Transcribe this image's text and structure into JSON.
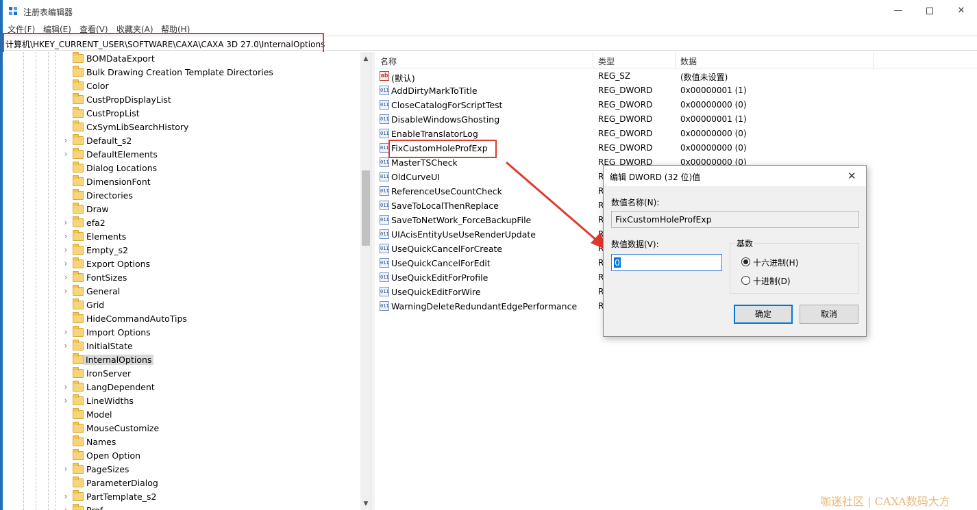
{
  "window": {
    "title": "注册表编辑器",
    "minimize_icon": "minimize-icon",
    "maximize_icon": "maximize-icon",
    "close_icon": "close-icon"
  },
  "menu": [
    "文件(F)",
    "编辑(E)",
    "查看(V)",
    "收藏夹(A)",
    "帮助(H)"
  ],
  "address": "计算机\\HKEY_CURRENT_USER\\SOFTWARE\\CAXA\\CAXA 3D 27.0\\InternalOptions",
  "tree": [
    {
      "label": "BOMDataExport",
      "expandable": false
    },
    {
      "label": "Bulk Drawing Creation Template Directories",
      "expandable": false
    },
    {
      "label": "Color",
      "expandable": false
    },
    {
      "label": "CustPropDisplayList",
      "expandable": false
    },
    {
      "label": "CustPropList",
      "expandable": false
    },
    {
      "label": "CxSymLibSearchHistory",
      "expandable": false
    },
    {
      "label": "Default_s2",
      "expandable": true
    },
    {
      "label": "DefaultElements",
      "expandable": true
    },
    {
      "label": "Dialog Locations",
      "expandable": false
    },
    {
      "label": "DimensionFont",
      "expandable": false
    },
    {
      "label": "Directories",
      "expandable": false
    },
    {
      "label": "Draw",
      "expandable": false
    },
    {
      "label": "efa2",
      "expandable": true
    },
    {
      "label": "Elements",
      "expandable": true
    },
    {
      "label": "Empty_s2",
      "expandable": true
    },
    {
      "label": "Export Options",
      "expandable": true
    },
    {
      "label": "FontSizes",
      "expandable": true
    },
    {
      "label": "General",
      "expandable": true
    },
    {
      "label": "Grid",
      "expandable": false
    },
    {
      "label": "HideCommandAutoTips",
      "expandable": false
    },
    {
      "label": "Import Options",
      "expandable": true
    },
    {
      "label": "InitialState",
      "expandable": true
    },
    {
      "label": "InternalOptions",
      "expandable": false,
      "selected": true
    },
    {
      "label": "IronServer",
      "expandable": false
    },
    {
      "label": "LangDependent",
      "expandable": true
    },
    {
      "label": "LineWidths",
      "expandable": true
    },
    {
      "label": "Model",
      "expandable": false
    },
    {
      "label": "MouseCustomize",
      "expandable": false
    },
    {
      "label": "Names",
      "expandable": false
    },
    {
      "label": "Open Option",
      "expandable": false
    },
    {
      "label": "PageSizes",
      "expandable": true
    },
    {
      "label": "ParameterDialog",
      "expandable": false
    },
    {
      "label": "PartTemplate_s2",
      "expandable": true
    },
    {
      "label": "Prof",
      "expandable": true
    }
  ],
  "list": {
    "columns": {
      "name": "名称",
      "type": "类型",
      "data": "数据"
    },
    "rows": [
      {
        "icon": "string-value-icon",
        "icon_text": "ab",
        "name": "(默认)",
        "type": "REG_SZ",
        "data": "(数值未设置)"
      },
      {
        "icon": "dword-value-icon",
        "icon_text": "011",
        "name": "AddDirtyMarkToTitle",
        "type": "REG_DWORD",
        "data": "0x00000001 (1)"
      },
      {
        "icon": "dword-value-icon",
        "icon_text": "011",
        "name": "CloseCatalogForScriptTest",
        "type": "REG_DWORD",
        "data": "0x00000000 (0)"
      },
      {
        "icon": "dword-value-icon",
        "icon_text": "011",
        "name": "DisableWindowsGhosting",
        "type": "REG_DWORD",
        "data": "0x00000001 (1)"
      },
      {
        "icon": "dword-value-icon",
        "icon_text": "011",
        "name": "EnableTranslatorLog",
        "type": "REG_DWORD",
        "data": "0x00000000 (0)"
      },
      {
        "icon": "dword-value-icon",
        "icon_text": "011",
        "name": "FixCustomHoleProfExp",
        "type": "REG_DWORD",
        "data": "0x00000000 (0)"
      },
      {
        "icon": "dword-value-icon",
        "icon_text": "011",
        "name": "MasterTSCheck",
        "type": "REG_DWORD",
        "data": "0x00000000 (0)"
      },
      {
        "icon": "dword-value-icon",
        "icon_text": "011",
        "name": "OldCurveUI",
        "type": "R",
        "data": ""
      },
      {
        "icon": "dword-value-icon",
        "icon_text": "011",
        "name": "ReferenceUseCountCheck",
        "type": "R",
        "data": ""
      },
      {
        "icon": "dword-value-icon",
        "icon_text": "011",
        "name": "SaveToLocalThenReplace",
        "type": "R",
        "data": ""
      },
      {
        "icon": "dword-value-icon",
        "icon_text": "011",
        "name": "SaveToNetWork_ForceBackupFile",
        "type": "R",
        "data": ""
      },
      {
        "icon": "dword-value-icon",
        "icon_text": "011",
        "name": "UIAcisEntityUseUseRenderUpdate",
        "type": "R",
        "data": ""
      },
      {
        "icon": "dword-value-icon",
        "icon_text": "011",
        "name": "UseQuickCancelForCreate",
        "type": "R",
        "data": ""
      },
      {
        "icon": "dword-value-icon",
        "icon_text": "011",
        "name": "UseQuickCancelForEdit",
        "type": "R",
        "data": ""
      },
      {
        "icon": "dword-value-icon",
        "icon_text": "011",
        "name": "UseQuickEditForProfile",
        "type": "R",
        "data": ""
      },
      {
        "icon": "dword-value-icon",
        "icon_text": "011",
        "name": "UseQuickEditForWire",
        "type": "R",
        "data": ""
      },
      {
        "icon": "dword-value-icon",
        "icon_text": "011",
        "name": "WarningDeleteRedundantEdgePerformance",
        "type": "R",
        "data": ""
      }
    ]
  },
  "dialog": {
    "title": "编辑 DWORD (32 位)值",
    "name_label": "数值名称(N):",
    "name_value": "FixCustomHoleProfExp",
    "data_label": "数值数据(V):",
    "data_value": "0",
    "base_label": "基数",
    "hex_label": "十六进制(H)",
    "dec_label": "十进制(D)",
    "base_selected": "hex",
    "ok": "确定",
    "cancel": "取消"
  },
  "annotations": {
    "highlight_color": "#e0392f"
  },
  "watermark": "咖迷社区 | CAXA数码大方"
}
